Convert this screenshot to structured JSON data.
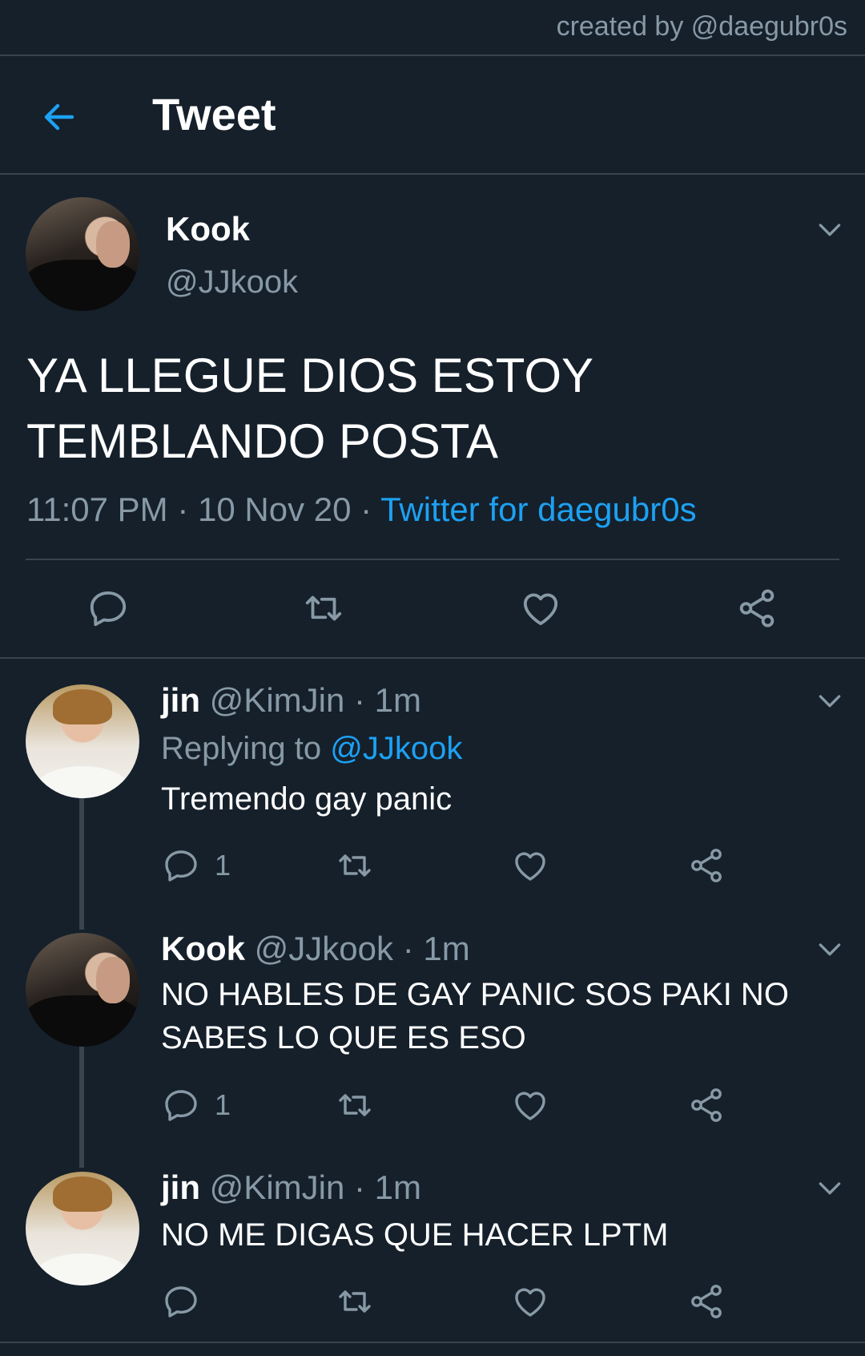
{
  "credit": "created by @daegubr0s",
  "header": {
    "title": "Tweet"
  },
  "main_tweet": {
    "name": "Kook",
    "handle": "@JJkook",
    "text": "YA LLEGUE DIOS ESTOY TEMBLANDO POSTA",
    "time": "11:07 PM",
    "date": "10 Nov 20",
    "source": "Twitter for daegubr0s"
  },
  "replies": [
    {
      "name": "jin",
      "handle": "@KimJin",
      "age": "1m",
      "replying_label": "Replying to",
      "replying_to": "@JJkook",
      "text": "Tremendo gay panic",
      "reply_count": "1"
    },
    {
      "name": "Kook",
      "handle": "@JJkook",
      "age": "1m",
      "text": "NO HABLES DE GAY PANIC SOS PAKI NO SABES LO QUE ES ESO",
      "reply_count": "1"
    },
    {
      "name": "jin",
      "handle": "@KimJin",
      "age": "1m",
      "text": "NO ME DIGAS QUE HACER LPTM",
      "reply_count": ""
    }
  ],
  "separator": "·",
  "colors": {
    "background": "#15202b",
    "accent": "#1da1f2",
    "muted": "#8899a6",
    "divider": "#38444d"
  },
  "icons": [
    "back-arrow-icon",
    "chevron-down-icon",
    "reply-icon",
    "retweet-icon",
    "like-icon",
    "share-icon"
  ]
}
